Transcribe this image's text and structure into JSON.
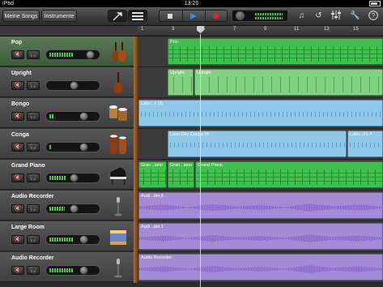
{
  "status_bar": {
    "device": "iPad",
    "time": "13:26"
  },
  "toolbar": {
    "my_songs_label": "Meine Songs",
    "instruments_label": "Instrumente",
    "icons": [
      "instrument-view-icon",
      "tracks-view-icon",
      "stop-icon",
      "play-icon",
      "record-icon",
      "master-volume-icon",
      "guitar-pick-icon",
      "loop-icon",
      "mixer-icon",
      "settings-wrench-icon",
      "help-icon"
    ]
  },
  "ruler": {
    "bars": [
      "1",
      "3",
      "5",
      "7",
      "9",
      "11",
      "13",
      "15"
    ]
  },
  "tracks": [
    {
      "name": "Pop",
      "selected": true,
      "level": 0.55,
      "knob": 0.92,
      "instrument": "violin-icon",
      "color": "green",
      "regions": [
        {
          "label": "Pop"
        }
      ]
    },
    {
      "name": "Upright",
      "level": 0.0,
      "knob": 0.55,
      "instrument": "upright-bass-icon",
      "color": "lgreen",
      "regions": [
        {
          "label": "Upright"
        },
        {
          "label": "Upright"
        }
      ]
    },
    {
      "name": "Bongo",
      "level": 0.1,
      "knob": 0.78,
      "instrument": "bongo-icon",
      "color": "blue",
      "regions": [
        {
          "label": "Latin...s 05"
        }
      ]
    },
    {
      "name": "Conga",
      "level": 0.03,
      "knob": 0.78,
      "instrument": "conga-icon",
      "color": "blue",
      "regions": [
        {
          "label": "Latin Day Conga 01"
        },
        {
          "label": "Latin...01.4"
        }
      ]
    },
    {
      "name": "Grand Piano",
      "level": 0.4,
      "knob": 0.55,
      "instrument": "grand-piano-icon",
      "color": "green",
      "regions": [
        {
          "label": "Gran...iano"
        },
        {
          "label": "Gran...iano"
        },
        {
          "label": "Grand Piano"
        }
      ]
    },
    {
      "name": "Audio Recorder",
      "level": 0.35,
      "knob": 0.55,
      "instrument": "microphone-icon",
      "color": "purple",
      "regions": [
        {
          "label": "Audi...der.6"
        }
      ]
    },
    {
      "name": "Large Room",
      "level": 0.55,
      "knob": 0.78,
      "instrument": "drum-kit-icon",
      "color": "purple",
      "regions": [
        {
          "label": "Audi...der.1"
        }
      ]
    },
    {
      "name": "Audio Recorder",
      "level": 0.55,
      "knob": 0.78,
      "instrument": "microphone-icon",
      "color": "purple",
      "regions": [
        {
          "label": "Audio Recorder"
        }
      ]
    }
  ]
}
